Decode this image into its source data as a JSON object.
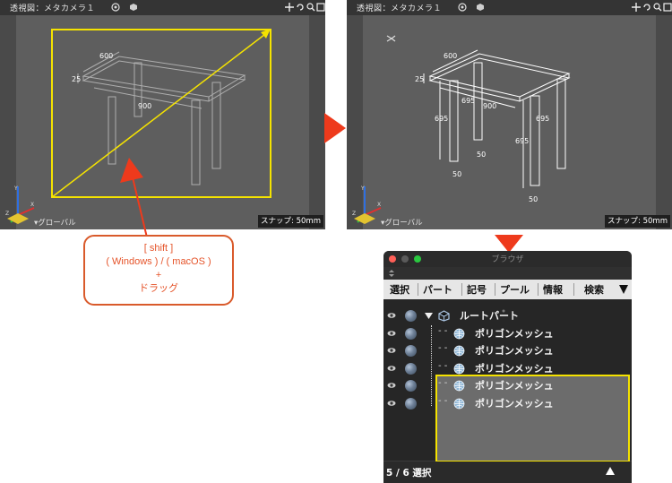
{
  "viewport_left": {
    "title": "透視図：メタカメラ１",
    "snap": "スナップ: 50mm",
    "global": "▾グローバル",
    "dims": [
      "600",
      "25",
      "900"
    ]
  },
  "viewport_right": {
    "title": "透視図：メタカメラ１",
    "snap": "スナップ: 50mm",
    "global": "▾グローバル",
    "dims": [
      "600",
      "25",
      "695",
      "900",
      "695",
      "50",
      "695",
      "50",
      "695",
      "50"
    ]
  },
  "callout": {
    "line1": "[ shift ]",
    "line2": "( Windows ) / ( macOS )",
    "line3": "+",
    "line4": "ドラッグ"
  },
  "browser": {
    "title": "ブラウザ",
    "tabs": [
      "選択",
      "パート",
      "記号",
      "プール",
      "情報",
      "検索"
    ],
    "tab_menu_icon": "triangle-down-icon",
    "root_label": "ルートパート",
    "items": [
      "ポリゴンメッシュ",
      "ポリゴンメッシュ",
      "ポリゴンメッシュ",
      "ポリゴンメッシュ",
      "ポリゴンメッシュ"
    ],
    "selection_count": "5 / 6 選択",
    "footer_icon": "triangle-up-icon"
  },
  "colors": {
    "highlight": "#f5e300",
    "accent_orange": "#e5542a",
    "arrow_red": "#ee3a1c"
  }
}
